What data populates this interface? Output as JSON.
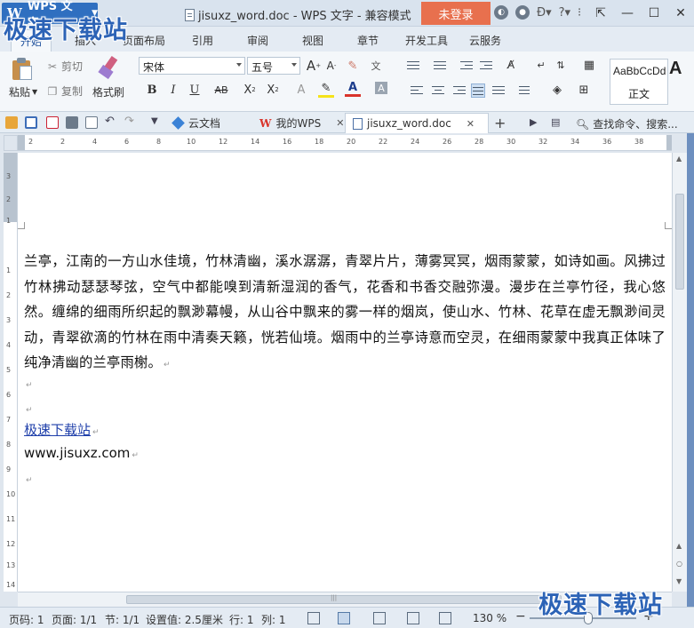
{
  "app": {
    "name": "WPS 文字",
    "window_title": "jisuxz_word.doc - WPS 文字 - 兼容模式",
    "login_label": "未登录"
  },
  "menu": {
    "tabs": [
      "开始",
      "插入",
      "页面布局",
      "引用",
      "审阅",
      "视图",
      "章节",
      "开发工具",
      "云服务"
    ],
    "active": "开始"
  },
  "ribbon": {
    "paste": "粘贴",
    "cut": "剪切",
    "copy": "复制",
    "format_painter": "格式刷",
    "font_name": "宋体",
    "font_size": "五号",
    "style_sample": "AaBbCcDd",
    "style_name": "正文",
    "style_next": "A"
  },
  "doc_tabs": [
    {
      "label": "云文档",
      "icon": "cloud-cube-icon"
    },
    {
      "label": "我的WPS",
      "icon": "wps-logo-icon"
    },
    {
      "label": "jisuxz_word.doc",
      "icon": "document-icon"
    }
  ],
  "search_placeholder": "查找命令、搜索...",
  "ruler": {
    "h_ticks": [
      "2",
      "2",
      "4",
      "6",
      "8",
      "10",
      "12",
      "14",
      "16",
      "18",
      "20",
      "22",
      "24",
      "26",
      "28",
      "30",
      "32",
      "34",
      "36",
      "38"
    ],
    "v_ticks": [
      "3",
      "2",
      "1",
      "1",
      "2",
      "3",
      "4",
      "5",
      "6",
      "7",
      "8",
      "9",
      "10",
      "11",
      "12",
      "13",
      "14"
    ]
  },
  "document": {
    "paragraph": "兰亭，江南的一方山水佳境，竹林清幽，溪水潺潺，青翠片片，薄雾冥冥，烟雨蒙蒙，如诗如画。风拂过竹林拂动瑟瑟琴弦，空气中都能嗅到清新湿润的香气，花香和书香交融弥漫。漫步在兰亭竹径，我心悠然。缠绵的细雨所织起的飘渺幕幔，从山谷中飘来的雾一样的烟岚，使山水、竹林、花草在虚无飘渺间灵动，青翠欲滴的竹林在雨中清奏天籁，恍若仙境。烟雨中的兰亭诗意而空灵，在细雨蒙蒙中我真正体味了纯净清幽的兰亭雨榭。",
    "link_text": "极速下载站",
    "url_text": "www.jisuxz.com",
    "para_mark": "↵"
  },
  "status": {
    "page_no": "页码: 1",
    "pages": "页面: 1/1",
    "section": "节: 1/1",
    "setting": "设置值: 2.5厘米",
    "row": "行: 1",
    "col": "列: 1",
    "zoom": "130 %",
    "zoom_level": 0.55
  },
  "watermark": "极速下载站",
  "colors": {
    "accent": "#2f6fc0",
    "login": "#e8704e",
    "link": "#1f3faa"
  }
}
